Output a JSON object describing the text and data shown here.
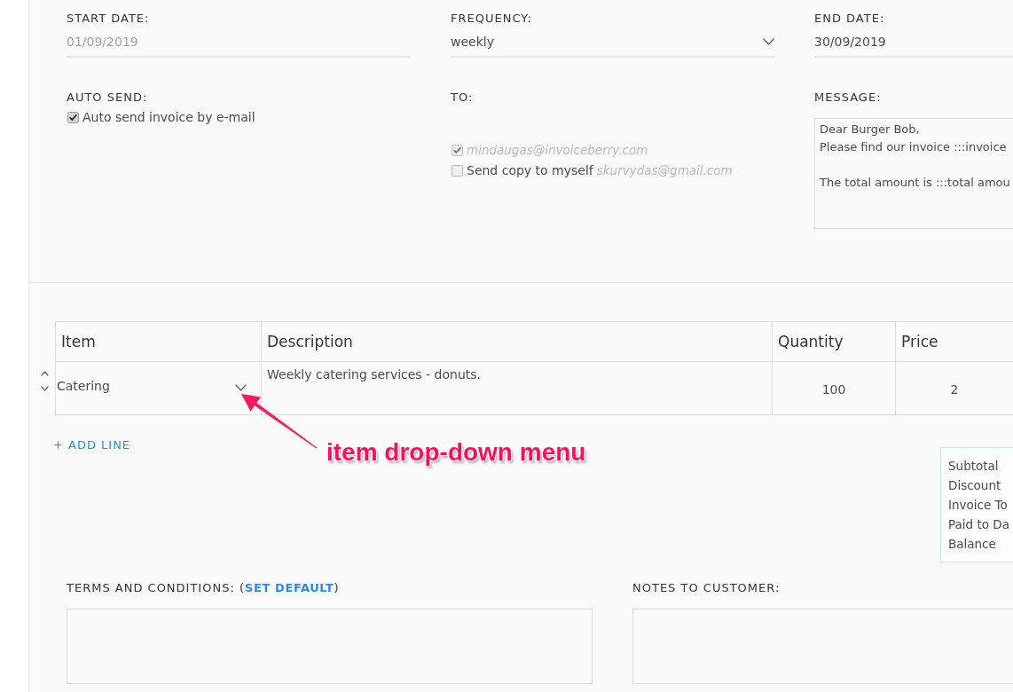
{
  "schedule": {
    "fields": [
      {
        "kind": "date",
        "label": "START DATE:",
        "value": "01/09/2019",
        "disabled": true
      },
      {
        "kind": "select",
        "label": "FREQUENCY:",
        "value": "weekly",
        "disabled": false
      },
      {
        "kind": "date",
        "label": "END DATE:",
        "value": "30/09/2019",
        "disabled": false
      }
    ]
  },
  "auto_send": {
    "label": "AUTO SEND:",
    "options": [
      {
        "text": "Auto send invoice by e-mail",
        "checked": true,
        "disabled": false
      }
    ]
  },
  "recipients": {
    "label": "TO:",
    "options": [
      {
        "email": "mindaugas@invoiceberry.com",
        "checked": true,
        "disabled": true
      },
      {
        "text": "Send copy to myself",
        "email": "skurvydas@gmail.com",
        "checked": false,
        "disabled": false
      }
    ]
  },
  "message": {
    "label": "MESSAGE:",
    "value": "Dear Burger Bob,\nPlease find our invoice :::invoice\n\nThe total amount is :::total amou"
  },
  "line_items": {
    "columns": [
      "Item",
      "Description",
      "Quantity",
      "Price"
    ],
    "rows": [
      {
        "item": "Catering",
        "description": "Weekly catering services - donuts.",
        "quantity": "100",
        "price": "2"
      }
    ]
  },
  "add_line": "+ ADD LINE",
  "totals": {
    "labels": [
      "Subtotal",
      "Discount",
      "Invoice To",
      "Paid to Da",
      "Balance"
    ]
  },
  "terms": {
    "label_before": "TERMS AND CONDITIONS: (",
    "link": "SET DEFAULT",
    "label_after": ")"
  },
  "notes": {
    "label": "NOTES TO CUSTOMER:"
  },
  "annotation": {
    "text": "item drop-down menu"
  }
}
